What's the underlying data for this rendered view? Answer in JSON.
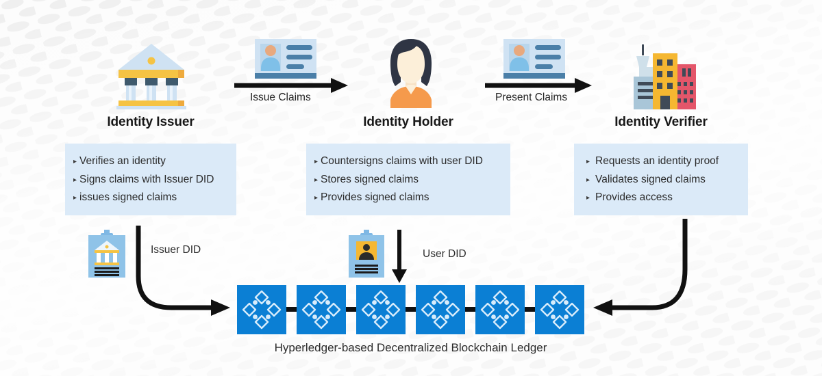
{
  "diagram": {
    "background_color": "#fbfbfb",
    "panel_color": "#dbeaf8",
    "block_color": "#0b7fd4",
    "arrow_color": "#111111"
  },
  "actors": [
    {
      "id": "issuer",
      "title": "Identity Issuer",
      "icon": "bank-icon",
      "bullets": [
        "Verifies an identity",
        "Signs claims with Issuer DID",
        "issues signed claims"
      ]
    },
    {
      "id": "holder",
      "title": "Identity Holder",
      "icon": "person-avatar-icon",
      "bullets": [
        "Countersigns claims with user DID",
        "Stores signed claims",
        "Provides signed claims"
      ]
    },
    {
      "id": "verifier",
      "title": "Identity Verifier",
      "icon": "buildings-icon",
      "bullets": [
        "Requests an identity proof",
        "Validates signed claims",
        "Provides access"
      ]
    }
  ],
  "flows": [
    {
      "id": "issue-claims",
      "label": "Issue Claims",
      "icon": "id-card-icon",
      "direction": "right"
    },
    {
      "id": "present-claims",
      "label": "Present Claims",
      "icon": "id-card-icon",
      "direction": "right"
    }
  ],
  "did_flows": [
    {
      "id": "issuer-did",
      "label": "Issuer DID",
      "icon": "issuer-did-badge-icon"
    },
    {
      "id": "user-did",
      "label": "User DID",
      "icon": "user-did-badge-icon"
    }
  ],
  "ledger": {
    "caption": "Hyperledger-based Decentralized Blockchain Ledger",
    "block_count": 6,
    "block_icon": "hyperledger-logo-icon"
  },
  "bullet_glyph": "▸"
}
